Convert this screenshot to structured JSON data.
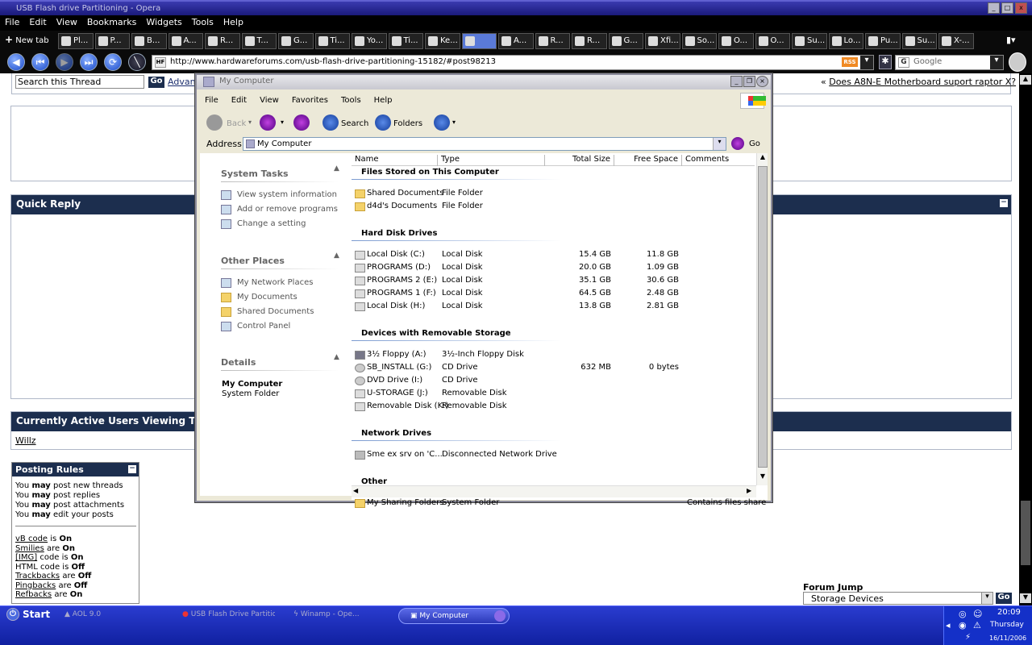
{
  "browser": {
    "title": "USB Flash drive Partitioning - Opera",
    "menu": [
      "File",
      "Edit",
      "View",
      "Bookmarks",
      "Widgets",
      "Tools",
      "Help"
    ],
    "new_tab": "New tab",
    "tabs": [
      {
        "label": "Pl..."
      },
      {
        "label": "P..."
      },
      {
        "label": "B..."
      },
      {
        "label": "A..."
      },
      {
        "label": "R..."
      },
      {
        "label": "T..."
      },
      {
        "label": "G..."
      },
      {
        "label": "Ti..."
      },
      {
        "label": "Yo..."
      },
      {
        "label": "Ti..."
      },
      {
        "label": "Ke..."
      },
      {
        "label": ""
      },
      {
        "label": "A..."
      },
      {
        "label": "R..."
      },
      {
        "label": "R..."
      },
      {
        "label": "G..."
      },
      {
        "label": "Xfi..."
      },
      {
        "label": "So..."
      },
      {
        "label": "O..."
      },
      {
        "label": "O..."
      },
      {
        "label": "Su..."
      },
      {
        "label": "Lo..."
      },
      {
        "label": "Pu..."
      },
      {
        "label": "Su..."
      },
      {
        "label": "X-..."
      }
    ],
    "url": "http://www.hardwareforums.com/usb-flash-drive-partitioning-15182/#post98213",
    "search_placeholder": "Google",
    "rss": "RSS"
  },
  "forum": {
    "search_thread_value": "Search this Thread",
    "go": "Go",
    "advanced": "Advan",
    "prev_thread_prefix": "«",
    "prev_thread": "Does A8N-E Motherboard suport raptor X?",
    "quick_reply": "Quick Reply",
    "active_users": "Currently Active Users Viewing This",
    "active_user": "Willz",
    "posting_rules_title": "Posting Rules",
    "rules": [
      {
        "pre": "You",
        "bold": "may",
        "post": "post new threads"
      },
      {
        "pre": "You",
        "bold": "may",
        "post": "post replies"
      },
      {
        "pre": "You",
        "bold": "may",
        "post": "post attachments"
      },
      {
        "pre": "You",
        "bold": "may",
        "post": "edit your posts"
      }
    ],
    "codes": [
      {
        "link": "vB code",
        "mid": "is",
        "state": "On"
      },
      {
        "link": "Smilies",
        "mid": "are",
        "state": "On"
      },
      {
        "link": "[IMG]",
        "mid": "code is",
        "state": "On"
      },
      {
        "link": "",
        "mid": "HTML code is",
        "state": "Off"
      },
      {
        "link": "Trackbacks",
        "mid": "are",
        "state": "Off"
      },
      {
        "link": "Pingbacks",
        "mid": "are",
        "state": "Off"
      },
      {
        "link": "Refbacks",
        "mid": "are",
        "state": "On"
      }
    ],
    "forum_jump_label": "Forum Jump",
    "forum_jump_value": "Storage Devices",
    "forum_jump_go": "Go"
  },
  "explorer": {
    "title": "My Computer",
    "menu": [
      "File",
      "Edit",
      "View",
      "Favorites",
      "Tools",
      "Help"
    ],
    "toolbar": {
      "back": "Back",
      "search": "Search",
      "folders": "Folders"
    },
    "address_label": "Address",
    "address_value": "My Computer",
    "go": "Go",
    "left": {
      "system_tasks": "System Tasks",
      "system_links": [
        "View system information",
        "Add or remove programs",
        "Change a setting"
      ],
      "other_places": "Other Places",
      "other_links": [
        "My Network Places",
        "My Documents",
        "Shared Documents",
        "Control Panel"
      ],
      "details": "Details",
      "details_name": "My Computer",
      "details_type": "System Folder"
    },
    "columns": [
      "Name",
      "Type",
      "Total Size",
      "Free Space",
      "Comments"
    ],
    "groups": [
      {
        "title": "Files Stored on This Computer",
        "rows": [
          {
            "name": "Shared Documents",
            "type": "File Folder",
            "total": "",
            "free": "",
            "comment": "",
            "icon": "folder"
          },
          {
            "name": "d4d's Documents",
            "type": "File Folder",
            "total": "",
            "free": "",
            "comment": "",
            "icon": "folder"
          }
        ]
      },
      {
        "title": "Hard Disk Drives",
        "rows": [
          {
            "name": "Local Disk (C:)",
            "type": "Local Disk",
            "total": "15.4 GB",
            "free": "11.8 GB",
            "comment": "",
            "icon": "disk"
          },
          {
            "name": "PROGRAMS (D:)",
            "type": "Local Disk",
            "total": "20.0 GB",
            "free": "1.09 GB",
            "comment": "",
            "icon": "disk"
          },
          {
            "name": "PROGRAMS 2 (E:)",
            "type": "Local Disk",
            "total": "35.1 GB",
            "free": "30.6 GB",
            "comment": "",
            "icon": "disk"
          },
          {
            "name": "PROGRAMS 1 (F:)",
            "type": "Local Disk",
            "total": "64.5 GB",
            "free": "2.48 GB",
            "comment": "",
            "icon": "disk"
          },
          {
            "name": "Local Disk (H:)",
            "type": "Local Disk",
            "total": "13.8 GB",
            "free": "2.81 GB",
            "comment": "",
            "icon": "disk"
          }
        ]
      },
      {
        "title": "Devices with Removable Storage",
        "rows": [
          {
            "name": "3½ Floppy (A:)",
            "type": "3½-Inch Floppy Disk",
            "total": "",
            "free": "",
            "comment": "",
            "icon": "floppy"
          },
          {
            "name": "SB_INSTALL (G:)",
            "type": "CD Drive",
            "total": "632 MB",
            "free": "0 bytes",
            "comment": "",
            "icon": "cd"
          },
          {
            "name": "DVD Drive (I:)",
            "type": "CD Drive",
            "total": "",
            "free": "",
            "comment": "",
            "icon": "cd"
          },
          {
            "name": "U-STORAGE (J:)",
            "type": "Removable Disk",
            "total": "",
            "free": "",
            "comment": "",
            "icon": "disk"
          },
          {
            "name": "Removable Disk (K:)",
            "type": "Removable Disk",
            "total": "",
            "free": "",
            "comment": "",
            "icon": "disk"
          }
        ]
      },
      {
        "title": "Network Drives",
        "rows": [
          {
            "name": "Sme ex srv on 'C...",
            "type": "Disconnected Network Drive",
            "total": "",
            "free": "",
            "comment": "",
            "icon": "net"
          }
        ]
      },
      {
        "title": "Other",
        "rows": [
          {
            "name": "My Sharing Folders",
            "type": "System Folder",
            "total": "",
            "free": "",
            "comment": "Contains files share",
            "icon": "folder"
          }
        ]
      }
    ]
  },
  "taskbar": {
    "start": "Start",
    "items": [
      "AOL 9.0",
      "USB Flash Drive Partitioni...",
      "Winamp - Ope...",
      "My Computer"
    ],
    "time": "20:09",
    "day": "Thursday",
    "date": "16/11/2006"
  },
  "colors": {
    "forum_header": "#1c2e4e",
    "taskbar": "#1a2cc0",
    "xp_face": "#ece9d8"
  }
}
